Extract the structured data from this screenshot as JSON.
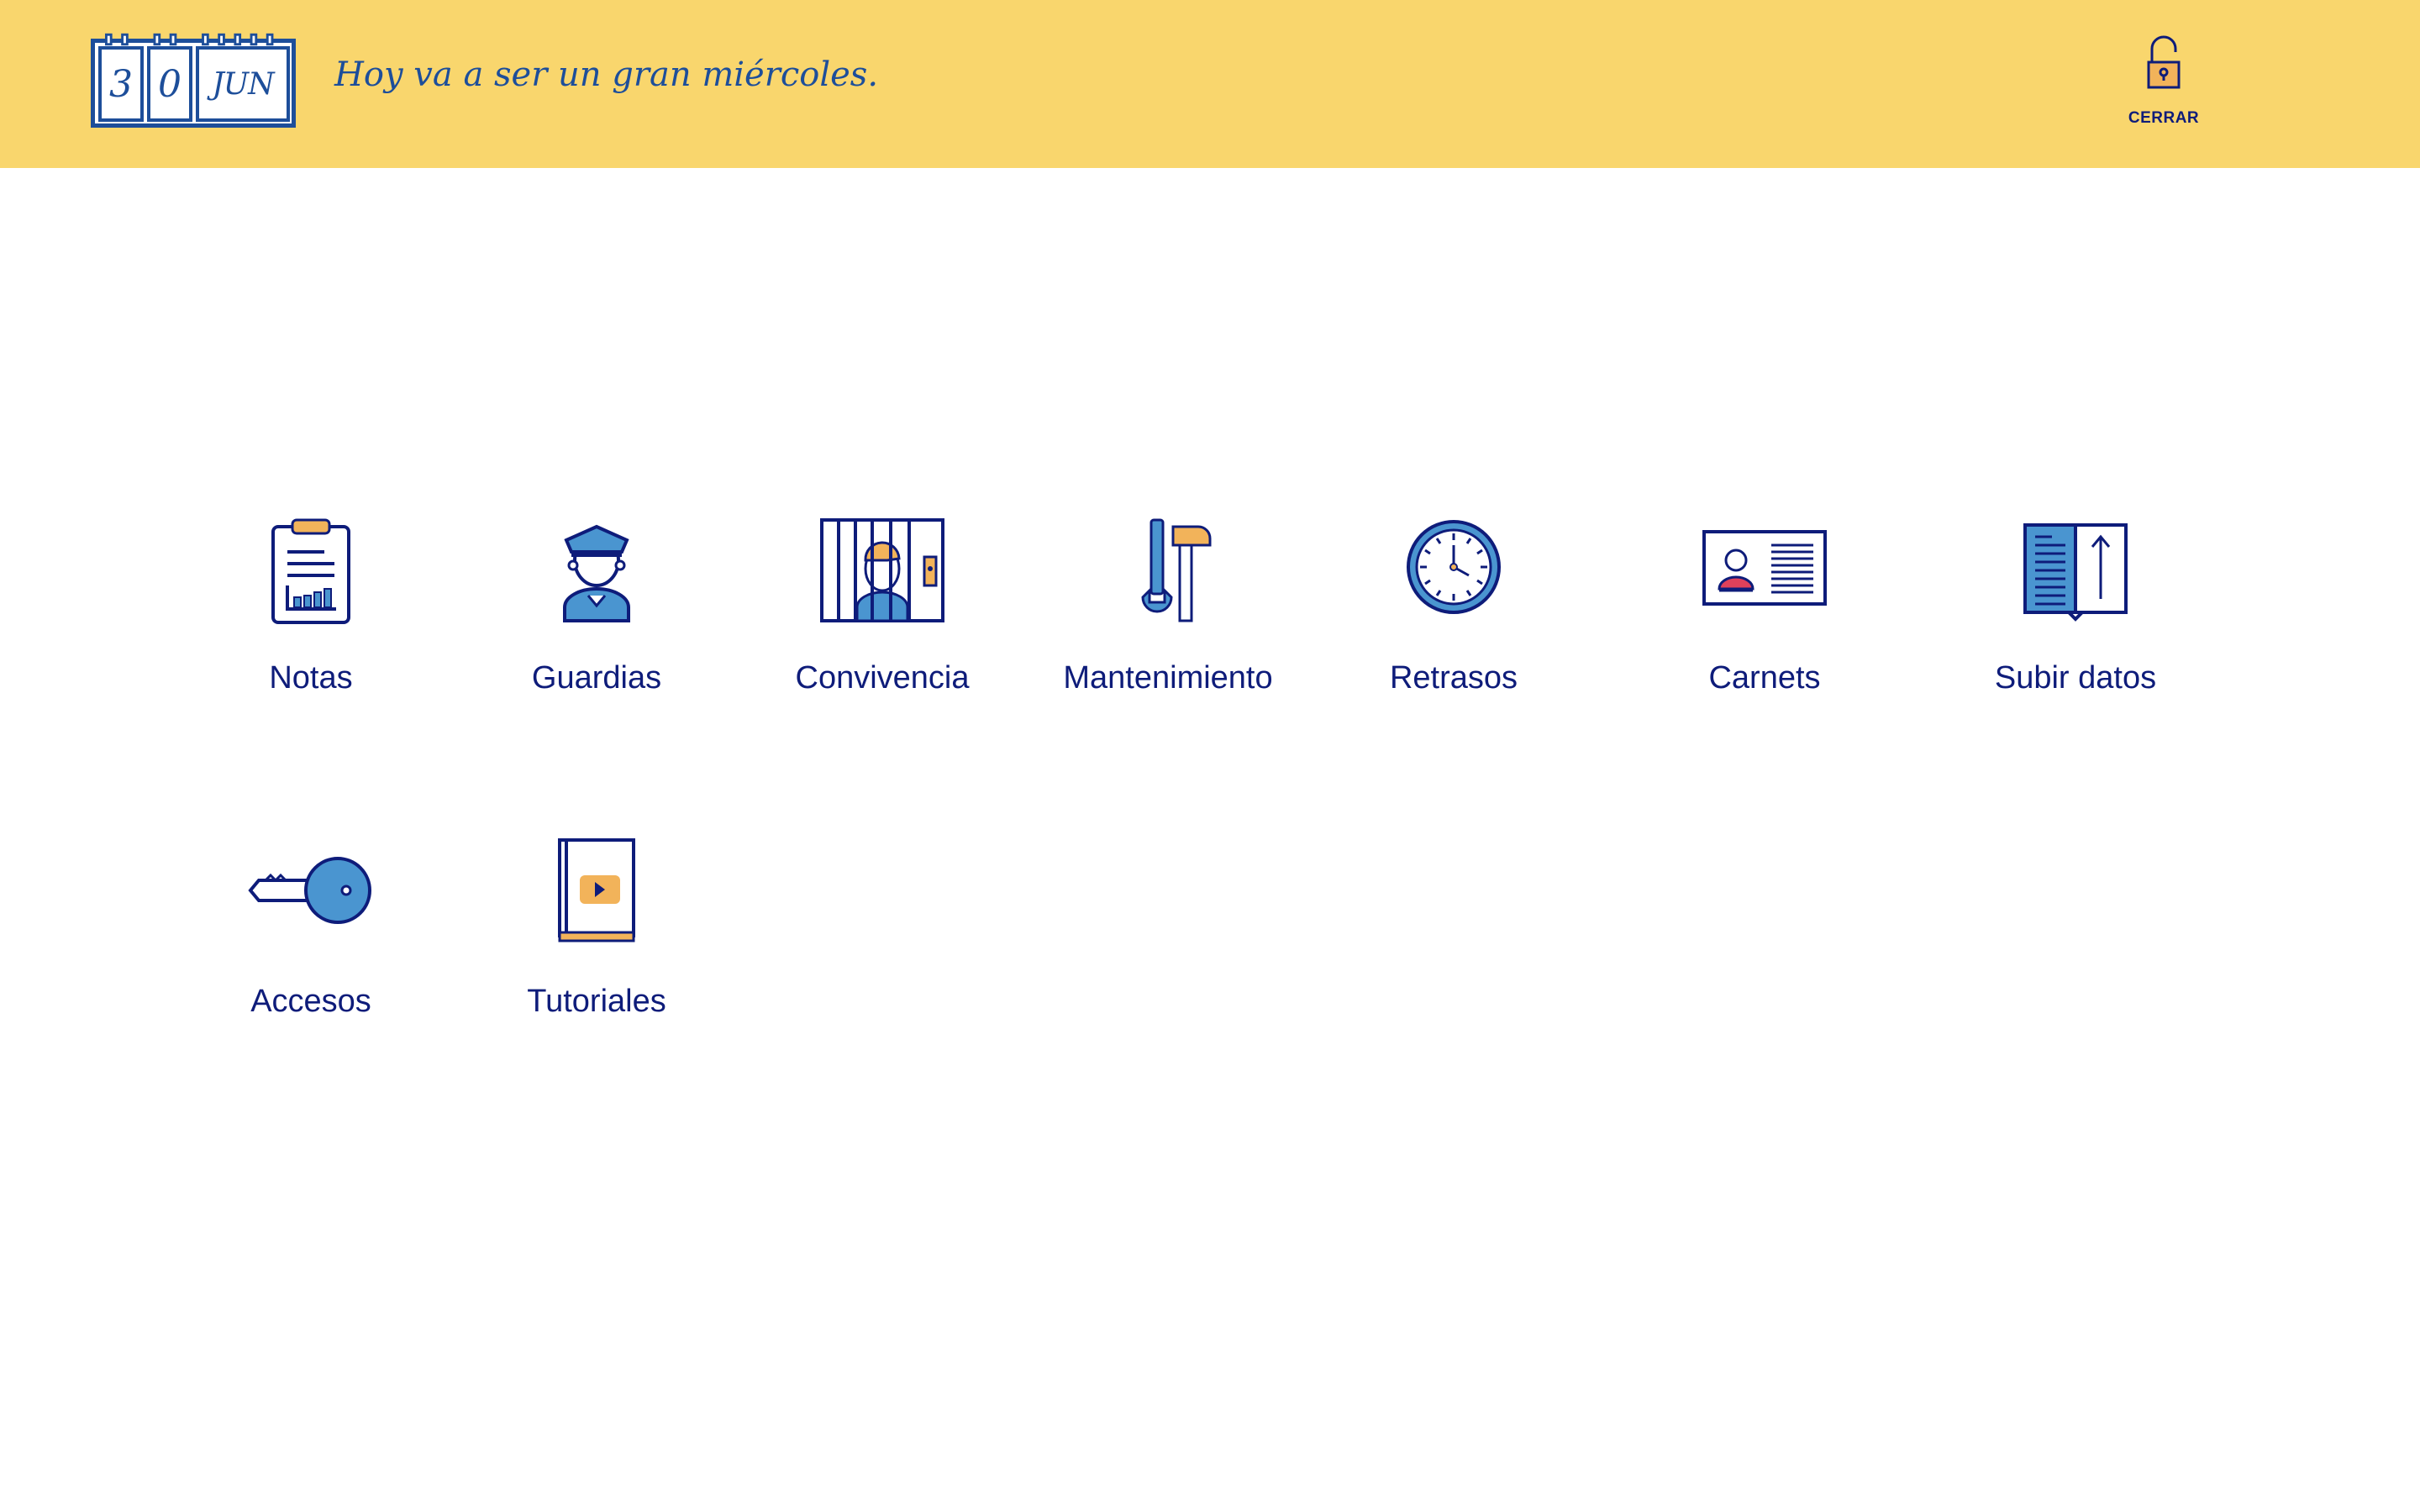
{
  "header": {
    "date": {
      "day_tens": "3",
      "day_units": "0",
      "month": "JUN"
    },
    "motto": "Hoy va a ser un gran miércoles.",
    "logout_label": "CERRAR"
  },
  "menu": [
    {
      "label": "Notas",
      "icon": "clipboard-chart-icon"
    },
    {
      "label": "Guardias",
      "icon": "guard-officer-icon"
    },
    {
      "label": "Convivencia",
      "icon": "jail-cell-icon"
    },
    {
      "label": "Mantenimiento",
      "icon": "wrench-hammer-icon"
    },
    {
      "label": "Retrasos",
      "icon": "clock-icon"
    },
    {
      "label": "Carnets",
      "icon": "id-card-icon"
    },
    {
      "label": "Subir datos",
      "icon": "book-upload-icon"
    },
    {
      "label": "Accesos",
      "icon": "key-icon"
    },
    {
      "label": "Tutoriales",
      "icon": "video-book-icon"
    }
  ],
  "colors": {
    "header_bg": "#f9d66d",
    "navy": "#0e1c7a",
    "blue": "#4a95d0",
    "orange": "#f2b35a"
  }
}
